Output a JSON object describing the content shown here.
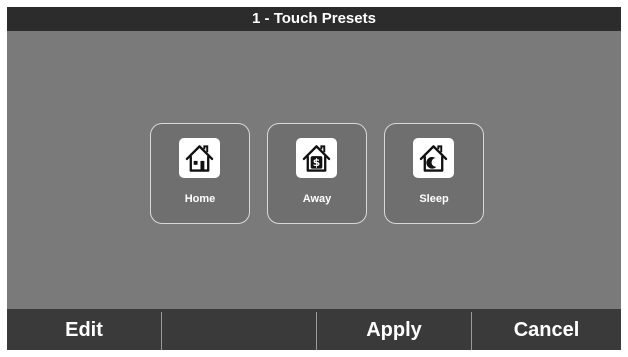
{
  "header": {
    "title": "1 - Touch Presets"
  },
  "presets": [
    {
      "label": "Home",
      "icon": "house-home-icon"
    },
    {
      "label": "Away",
      "icon": "house-away-dollar-icon"
    },
    {
      "label": "Sleep",
      "icon": "house-sleep-moon-icon"
    }
  ],
  "footer": {
    "edit_label": "Edit",
    "blank_label": "",
    "apply_label": "Apply",
    "cancel_label": "Cancel"
  },
  "colors": {
    "background": "#7a7a7a",
    "title_bar": "#2c2c2c",
    "bottom_bar": "#3a3a3a",
    "preset_border": "#d8d8d8",
    "icon_tile": "#ffffff"
  }
}
